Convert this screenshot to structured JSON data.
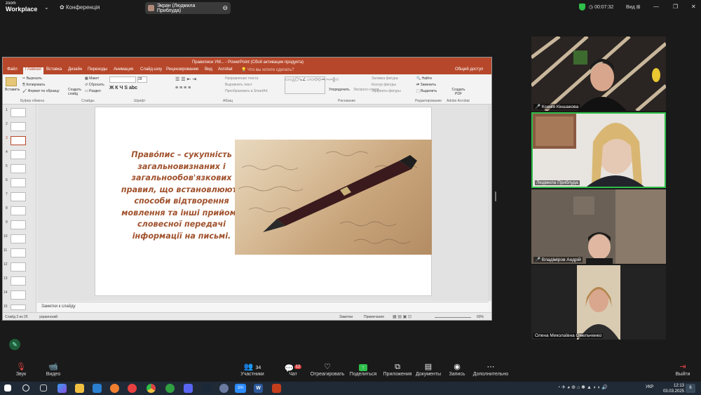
{
  "topbar": {
    "app_line1": "zoom",
    "app_line2": "Workplace",
    "conference_label": "Конференція",
    "share_label": "Экран (Людмила Приблуда)",
    "timer": "00:07:32",
    "view_label": "Вид"
  },
  "ppt": {
    "window_title": "Правописи УМ... - PowerPoint (Сбой активации продукта)",
    "tabs": [
      "Файл",
      "Главная",
      "Вставка",
      "Дизайн",
      "Переходы",
      "Анимация",
      "Слайд-шоу",
      "Рецензирование",
      "Вид",
      "Acrobat"
    ],
    "tell_me": "Что вы хотите сделать?",
    "share": "Общий доступ",
    "ribbon": {
      "paste": "Вставить",
      "cut": "Вырезать",
      "copy": "Копировать",
      "format_painter": "Формат по образцу",
      "new_slide": "Создать слайд",
      "layout": "Макет",
      "reset": "Сбросить",
      "section": "Раздел",
      "clipboard_group": "Буфер обмена",
      "slides_group": "Слайды",
      "font_group": "Шрифт",
      "paragraph_group": "Абзац",
      "drawing_group": "Рисование",
      "editing_group": "Редактирование",
      "acrobat_group": "Adobe Acrobat",
      "text_direction": "Направление текста",
      "align_text": "Выровнять текст",
      "smartart": "Преобразовать в SmartArt",
      "arrange": "Упорядочить",
      "quick_styles": "Экспресс-стили",
      "shape_fill": "Заливка фигуры",
      "shape_outline": "Контур фигуры",
      "shape_effects": "Эффекты фигуры",
      "find": "Найти",
      "replace": "Заменить",
      "select": "Выделить",
      "create_pdf": "Создать PDF",
      "font_size": "28"
    },
    "slide_numbers": [
      "1",
      "2",
      "3",
      "4",
      "5",
      "6",
      "7",
      "8",
      "9",
      "10",
      "11",
      "12",
      "13",
      "14",
      "15"
    ],
    "slide_text": "Право́пис – сукупність загальновизнаних і загальнообов'язкових правил, що встановлюють способи відтворення мовлення та інші прийоми словесної передачі інформації на письмі.",
    "notes_placeholder": "Заметки к слайду",
    "status_slide": "Слайд 3 из 25",
    "status_lang": "украинский",
    "status_notes": "Заметки",
    "status_comments": "Примечания",
    "zoom": "93%"
  },
  "participants": [
    {
      "name": "Ксенія Кіншакова"
    },
    {
      "name": "Людмила Приблуда"
    },
    {
      "name": "Владіміров Андрій"
    },
    {
      "name": "Олена Миколаївна Омельченко"
    }
  ],
  "toolbar": {
    "audio": "Звук",
    "video": "Видео",
    "participants": "Участники",
    "participants_count": "34",
    "chat": "Чат",
    "chat_badge": "12",
    "react": "Отреагировать",
    "share": "Поделиться",
    "apps": "Приложения",
    "docs": "Документы",
    "record": "Запись",
    "more": "Дополнительно",
    "leave": "Выйти"
  },
  "taskbar": {
    "lang": "УКР",
    "time": "12:13",
    "date": "03.03.2025",
    "notif_count": "6"
  },
  "colors": {
    "ppt_accent": "#b7472a",
    "slide_text": "#a0522d",
    "active_speaker": "#2fbf4a"
  }
}
